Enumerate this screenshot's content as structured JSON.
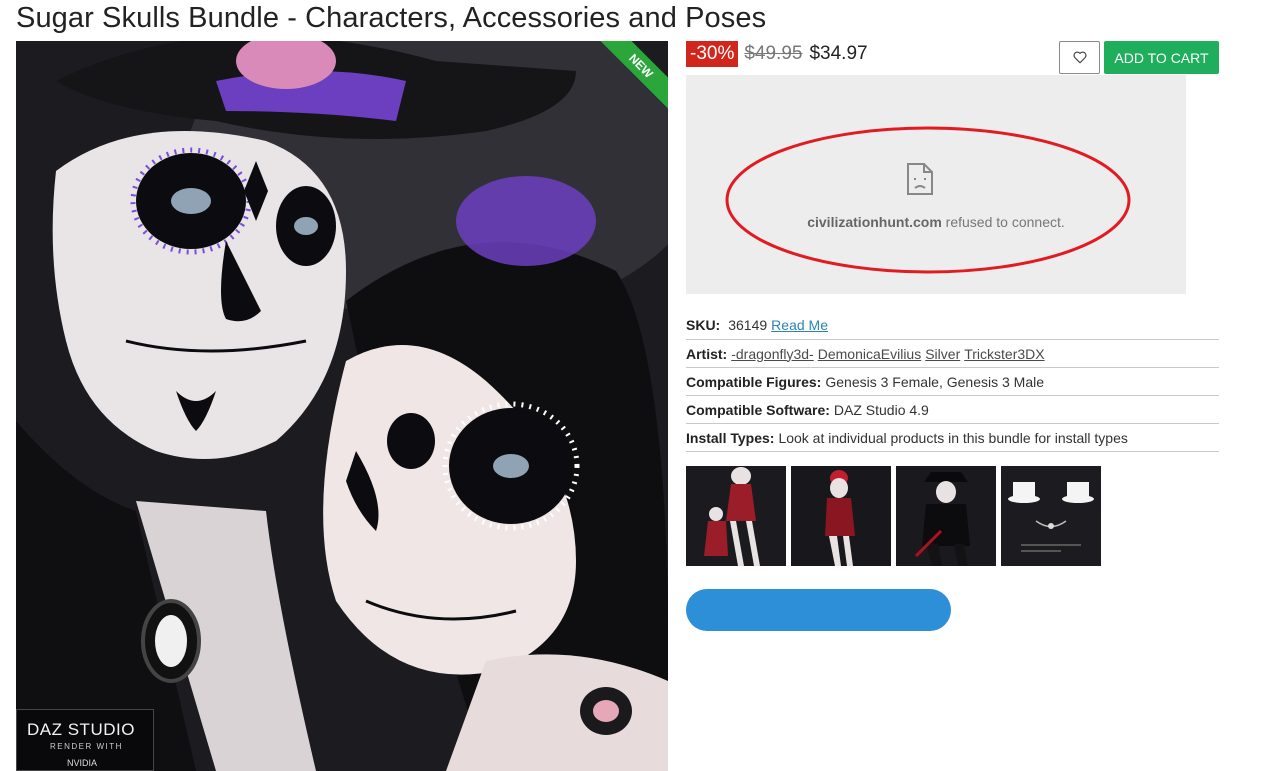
{
  "page": {
    "title": "Sugar Skulls Bundle - Characters, Accessories and Poses"
  },
  "hero": {
    "new_badge": "NEW",
    "daz_name": "DAZ STUDIO",
    "daz_sub": "RENDER WITH",
    "daz_nv": "NVIDIA"
  },
  "pricing": {
    "discount": "-30%",
    "old_price": "$49.95",
    "new_price": "$34.97"
  },
  "actions": {
    "wishlist_icon": "heart-icon",
    "add_to_cart": "ADD TO CART"
  },
  "embed": {
    "domain": "civilizationhunt.com",
    "message": " refused to connect."
  },
  "details": {
    "sku_label": "SKU:",
    "sku_value": "36149",
    "read_me": "Read Me",
    "artist_label": "Artist:",
    "artists": [
      "-dragonfly3d-",
      "DemonicaEvilius",
      "Silver",
      "Trickster3DX"
    ],
    "figures_label": "Compatible Figures:",
    "figures_value": "Genesis 3 Female, Genesis 3 Male",
    "software_label": "Compatible Software:",
    "software_value": "DAZ Studio 4.9",
    "install_label": "Install Types:",
    "install_value": "Look at individual products in this bundle for install types"
  },
  "colors": {
    "discount_bg": "#d0261b",
    "cart_bg": "#1fae5b",
    "blue_button": "#2d8fd8",
    "annotation_red": "#e11b22"
  }
}
